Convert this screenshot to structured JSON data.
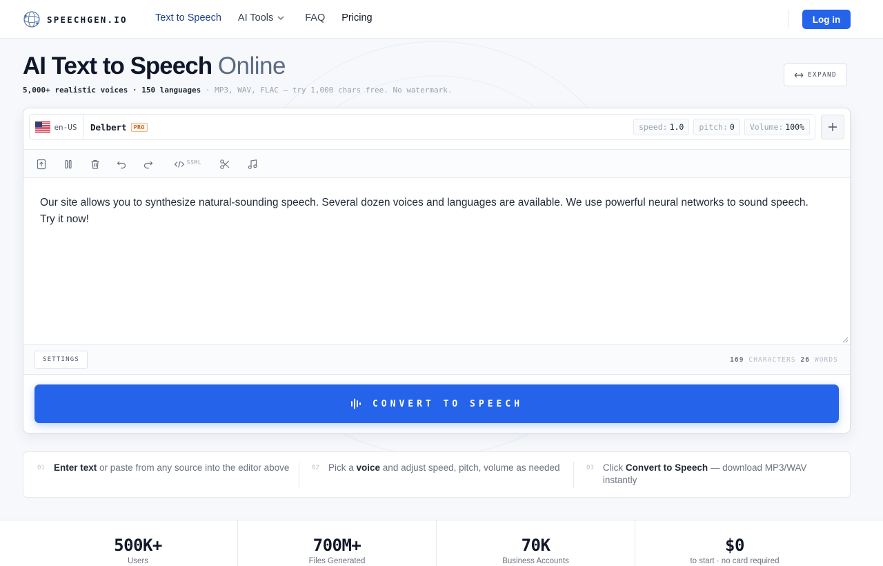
{
  "brand": {
    "name": "SPEECHGEN.IO"
  },
  "nav": {
    "items": [
      {
        "label": "Text to Speech",
        "active": true
      },
      {
        "label": "AI Tools",
        "has_dropdown": true
      },
      {
        "label": "FAQ"
      },
      {
        "label": "Pricing"
      }
    ],
    "login_label": "Log in"
  },
  "hero": {
    "title_bold": "AI Text to Speech",
    "title_light": "Online",
    "voices": "5,000+ realistic voices",
    "sep": "·",
    "languages": "150 languages",
    "rest": "· MP3, WAV, FLAC — try 1,000 chars free. No watermark.",
    "expand_label": "EXPAND"
  },
  "editor": {
    "lang_code": "en-US",
    "voice_name": "Delbert",
    "voice_badge": "PRO",
    "params": [
      {
        "label": "speed:",
        "value": "1.0"
      },
      {
        "label": "pitch:",
        "value": "0"
      },
      {
        "label": "Volume:",
        "value": "100%"
      }
    ],
    "toolbar": {
      "ssml_label": "SSML"
    },
    "text": "Our site allows you to synthesize natural-sounding speech. Several dozen voices and languages are available. We use powerful neural networks to sound speech. Try it now!",
    "settings_label": "SETTINGS",
    "char_count": "169",
    "char_label": "CHARACTERS",
    "word_count": "26",
    "word_label": "WORDS",
    "convert_label": "CONVERT TO SPEECH"
  },
  "steps": [
    {
      "num": "01",
      "bold": "Enter text",
      "rest": " or paste from any source into the editor above"
    },
    {
      "num": "02",
      "pre": "Pick a ",
      "bold": "voice",
      "rest": " and adjust speed, pitch, volume as needed"
    },
    {
      "num": "03",
      "pre": "Click ",
      "bold": "Convert to Speech",
      "rest": " — download MP3/WAV instantly"
    }
  ],
  "stats": [
    {
      "value": "500K+",
      "label": "Users"
    },
    {
      "value": "700M+",
      "label": "Files Generated"
    },
    {
      "value": "70K",
      "label": "Business Accounts"
    },
    {
      "value": "$0",
      "label": "to start · no card required"
    }
  ],
  "colors": {
    "accent": "#2563eb",
    "nav_active": "#1d3f8a",
    "pro_badge": "#c2601a"
  }
}
